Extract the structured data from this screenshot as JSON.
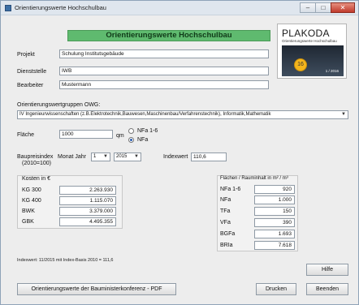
{
  "window": {
    "title": "Orientierungswerte Hochschulbau",
    "min": "–",
    "max": "□",
    "close": "✕"
  },
  "header": {
    "title": "Orientierungswerte Hochschulbau"
  },
  "logo": {
    "brand": "PLAKODA",
    "subtitle": "Orientierungswerte Hochschulbau",
    "badge": "16",
    "year": "1 / 2016"
  },
  "form": {
    "projekt_label": "Projekt",
    "projekt_value": "Schulung Institutsgebäude",
    "dienststelle_label": "Dienststelle",
    "dienststelle_value": "IWB",
    "bearbeiter_label": "Bearbeiter",
    "bearbeiter_value": "Mustermann",
    "owg_label": "Orientierungswertgruppen OWG:",
    "owg_value": "IV  Ingenieurwissenschaften (z.B.Elektrotechnik,Bauwesen,Maschinenbau/Verfahrenstechnik), Informatik,Mathematik",
    "flaeche_label": "Fläche",
    "flaeche_value": "1000",
    "flaeche_unit": "qm",
    "radio_nfa16": "NFa 1-6",
    "radio_nfa": "NFa",
    "baupreis_label": "Baupreisindex",
    "baupreis_sub": "(2010=100)",
    "monat_jahr_label": "Monat Jahr",
    "monat_value": "1",
    "jahr_value": "2015",
    "indexwert_label": "Indexwert",
    "indexwert_value": "110,6"
  },
  "kosten": {
    "title": "Kosten in €",
    "rows": [
      {
        "label": "KG 300",
        "value": "2.263.930"
      },
      {
        "label": "KG 400",
        "value": "1.115.070"
      },
      {
        "label": "BWK",
        "value": "3.379.000"
      },
      {
        "label": "GBK",
        "value": "4.495.355"
      }
    ]
  },
  "flaechen": {
    "title": "Flächen / Rauminhalt in m² / m³",
    "rows": [
      {
        "label": "NFa 1-6",
        "value": "920"
      },
      {
        "label": "NFa",
        "value": "1.000"
      },
      {
        "label": "TFa",
        "value": "150"
      },
      {
        "label": "VFa",
        "value": "390"
      },
      {
        "label": "BGFa",
        "value": "1.693"
      },
      {
        "label": "BRIa",
        "value": "7.618"
      }
    ]
  },
  "note": "Indexwert: 11/2015 mit Index-Basis 2010 = 111,6",
  "buttons": {
    "hilfe": "Hilfe",
    "pdf": "Orientierungswerte der Bauministerkonferenz - PDF",
    "drucken": "Drucken",
    "beenden": "Beenden"
  }
}
